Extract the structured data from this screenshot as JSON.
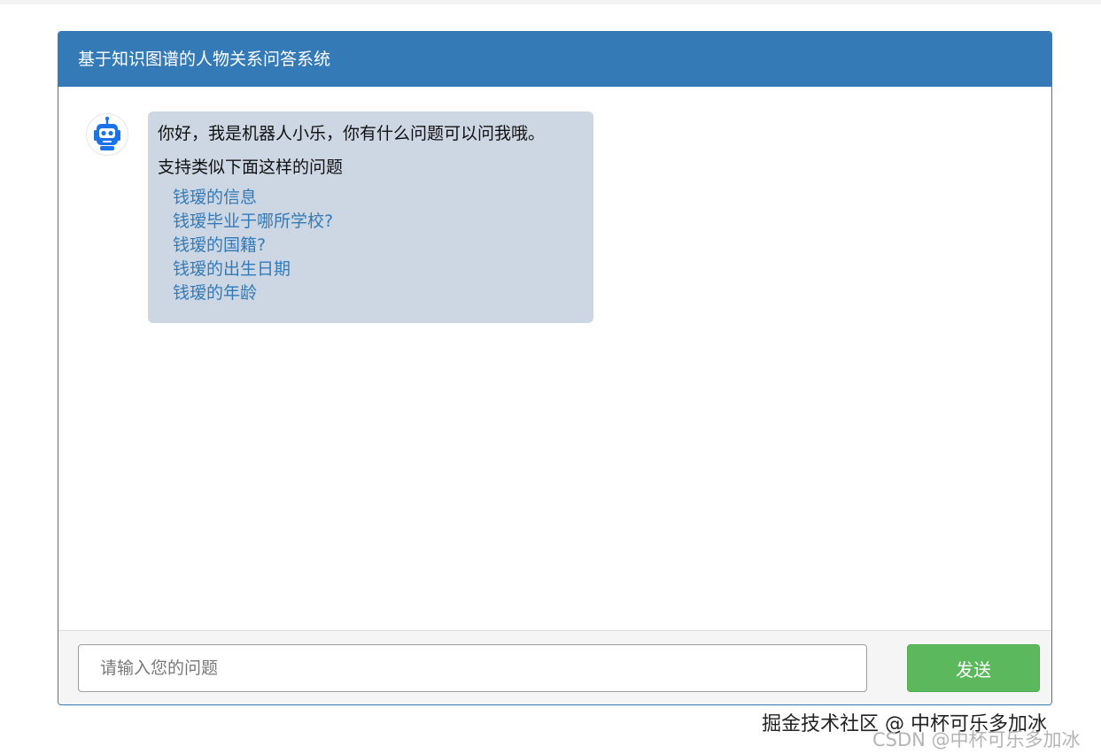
{
  "header": {
    "title": "基于知识图谱的人物关系问答系统"
  },
  "chat": {
    "messages": [
      {
        "sender": "robot",
        "avatar_icon": "robot-icon",
        "greeting": "你好，我是机器人小乐，你有什么问题可以问我哦。",
        "intro": "支持类似下面这样的问题",
        "suggestions": [
          "钱瑷的信息",
          "钱瑷毕业于哪所学校?",
          "钱瑷的国籍?",
          "钱瑷的出生日期",
          "钱瑷的年龄"
        ]
      }
    ]
  },
  "footer": {
    "input_value": "",
    "input_placeholder": "请输入您的问题",
    "send_label": "发送"
  },
  "watermark": {
    "main": "掘金技术社区 @ 中杯可乐多加冰",
    "sub": "CSDN @中杯可乐多加冰"
  },
  "colors": {
    "primary": "#337ab7",
    "bubble_bg": "#cdd7e4",
    "send_button": "#5cb85c",
    "link": "#337ab7",
    "robot_blue": "#1a73e8"
  }
}
